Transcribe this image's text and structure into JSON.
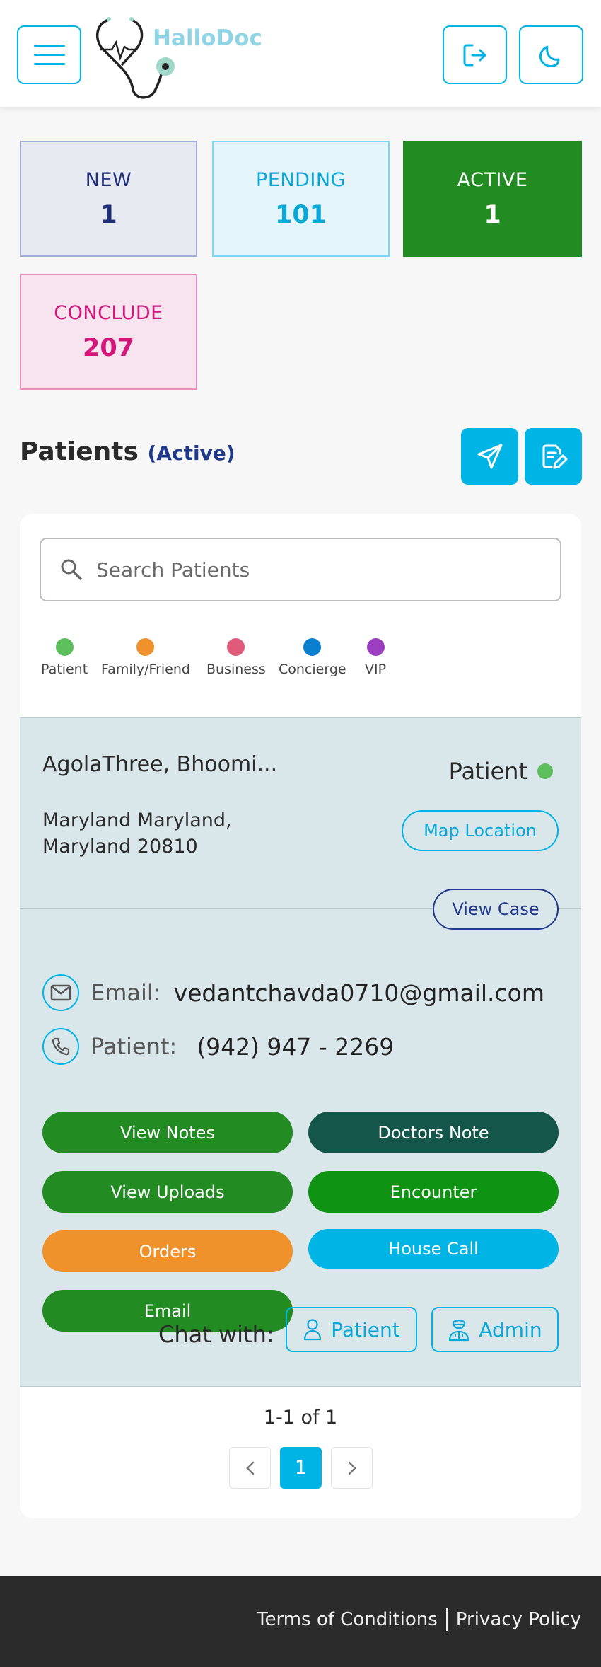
{
  "brand": {
    "name": "HalloDoc"
  },
  "stats": [
    {
      "label": "NEW",
      "count": "1"
    },
    {
      "label": "PENDING",
      "count": "101"
    },
    {
      "label": "ACTIVE",
      "count": "1"
    },
    {
      "label": "CONCLUDE",
      "count": "207"
    }
  ],
  "section": {
    "title": "Patients",
    "status": "(Active)"
  },
  "search": {
    "placeholder": "Search Patients",
    "value": ""
  },
  "legend": [
    {
      "label": "Patient",
      "color": "#5cbf5c"
    },
    {
      "label": "Family/Friend",
      "color": "#f0922b"
    },
    {
      "label": "Business",
      "color": "#e05a7a"
    },
    {
      "label": "Concierge",
      "color": "#0a7fcf"
    },
    {
      "label": "VIP",
      "color": "#9b3fc0"
    }
  ],
  "request": {
    "name": "AgolaThree, Bhoomi...",
    "type": "Patient",
    "address_line1": "Maryland Maryland,",
    "address_line2": "Maryland 20810",
    "map_label": "Map Location",
    "view_case_label": "View Case",
    "email_label": "Email:",
    "email": "vedantchavda0710@gmail.com",
    "phone_label": "Patient:",
    "phone": "(942) 947 - 2269",
    "actions": {
      "view_notes": "View Notes",
      "doctors_note": "Doctors Note",
      "view_uploads": "View Uploads",
      "encounter": "Encounter",
      "orders": "Orders",
      "house_call": "House Call",
      "email": "Email"
    },
    "chat_label": "Chat with:",
    "chat_patient": "Patient",
    "chat_admin": "Admin"
  },
  "pagination": {
    "summary": "1-1 of 1",
    "current": "1"
  },
  "footer": {
    "terms": "Terms of Conditions",
    "privacy": "Privacy Policy"
  },
  "colors": {
    "accent": "#00b4e6",
    "active_green": "#228b22",
    "doctors_note": "#15564a",
    "encounter": "#0e9412",
    "orders": "#f0922b"
  }
}
